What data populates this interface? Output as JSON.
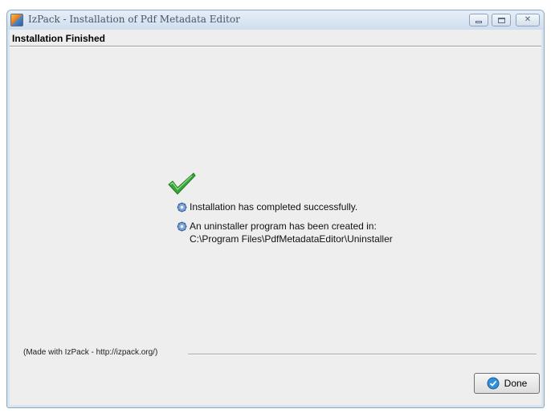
{
  "window": {
    "title": "IzPack - Installation of  Pdf Metadata Editor",
    "controls": {
      "minimize": "minimize",
      "maximize": "maximize",
      "close": "✕"
    }
  },
  "panel": {
    "heading": "Installation Finished"
  },
  "messages": {
    "completed": "Installation has completed successfully.",
    "uninstaller": "An uninstaller program has been created in:",
    "uninstaller_path": "C:\\Program Files\\PdfMetadataEditor\\Uninstaller"
  },
  "footer": {
    "credit": "(Made with IzPack - http://izpack.org/)"
  },
  "buttons": {
    "done": "Done"
  },
  "icons": {
    "app": "izpack-app-icon",
    "success": "green-checkmark-icon",
    "bullet": "gear-icon",
    "done": "ok-icon"
  },
  "colors": {
    "accent": "#2f8fd8",
    "success": "#3aa63a"
  }
}
